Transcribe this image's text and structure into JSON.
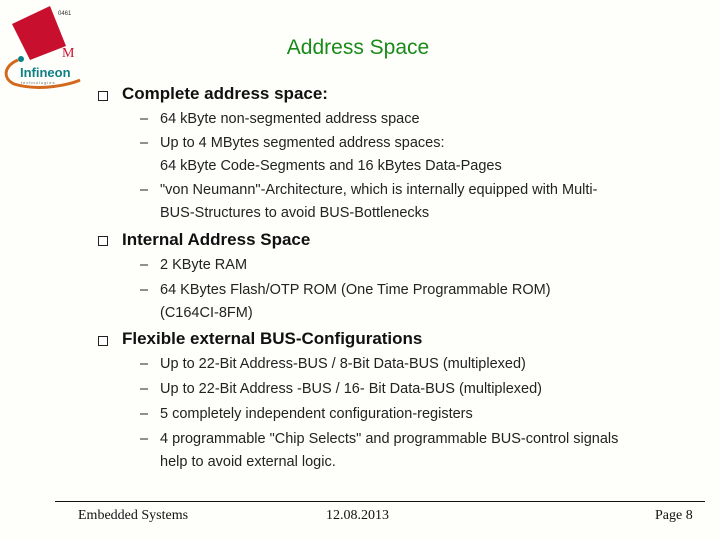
{
  "logo": {
    "code": "0461",
    "letter": "M",
    "brand": "Infineon",
    "tagline": "technologies",
    "colors": {
      "red": "#c8102e",
      "teal": "#0f7f86",
      "orange": "#d2691e"
    }
  },
  "title": "Address Space",
  "sections": [
    {
      "heading": "Complete address space:",
      "items": [
        [
          "64 kByte non-segmented address space"
        ],
        [
          "Up to 4 MBytes segmented address spaces:",
          "64 kByte Code-Segments and 16 kBytes Data-Pages"
        ],
        [
          "\"von Neumann\"-Architecture, which is  internally equipped with Multi-",
          "BUS-Structures to avoid BUS-Bottlenecks"
        ]
      ]
    },
    {
      "heading": "Internal Address Space",
      "items": [
        [
          "2 KByte RAM"
        ],
        [
          "64 KBytes Flash/OTP ROM (One Time Programmable ROM)",
          "(C164CI-8FM)"
        ]
      ]
    },
    {
      "heading": "Flexible external BUS-Configurations",
      "items": [
        [
          "Up to 22-Bit Address-BUS / 8-Bit Data-BUS (multiplexed)"
        ],
        [
          "Up to 22-Bit Address -BUS / 16- Bit Data-BUS (multiplexed)"
        ],
        [
          "5 completely independent configuration-registers"
        ],
        [
          "4 programmable \"Chip Selects\" and programmable BUS-control signals",
          "help to avoid external logic."
        ]
      ]
    }
  ],
  "dash_glyph": "–",
  "footer": {
    "left": "Embedded Systems",
    "center": "12.08.2013",
    "right": "Page 8"
  },
  "colors": {
    "title": "#1a8a1a",
    "background": "#fefffb"
  }
}
